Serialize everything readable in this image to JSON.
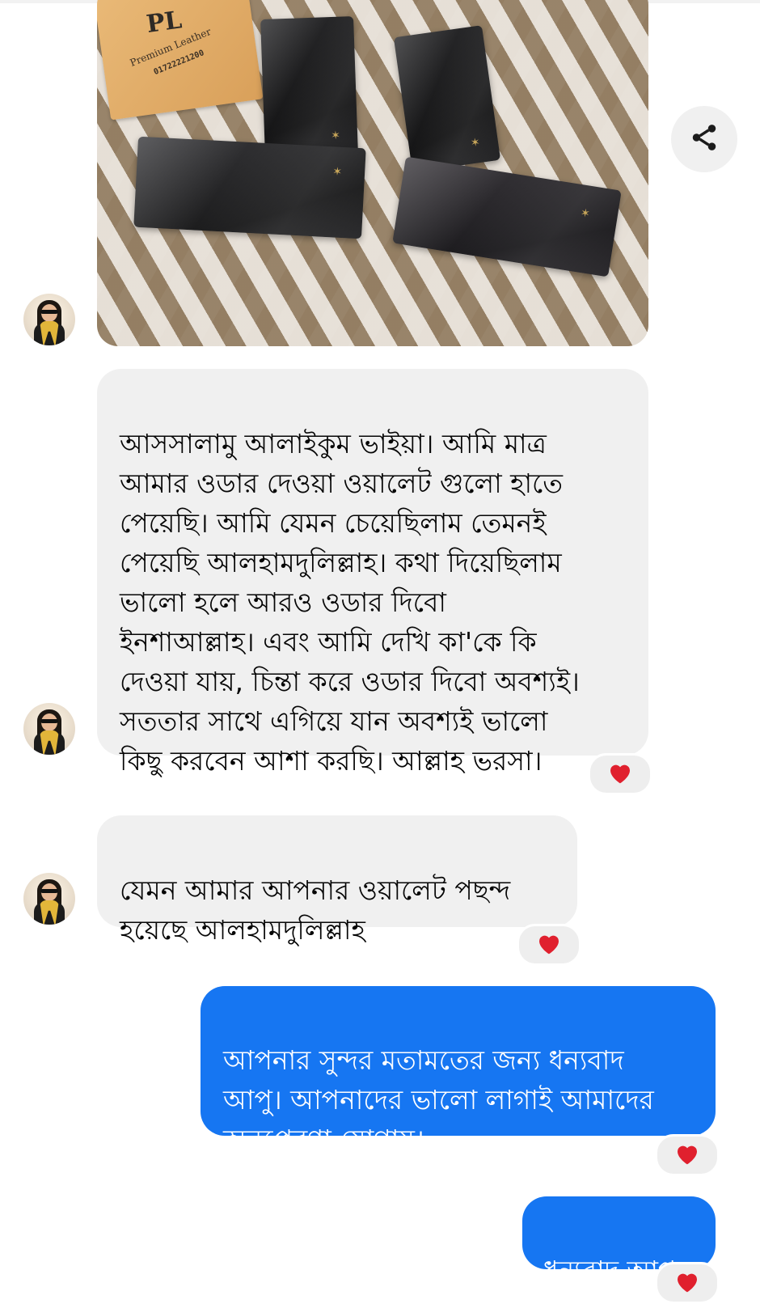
{
  "messages": [
    {
      "direction": "incoming",
      "type": "image",
      "image_tag": {
        "logo": "PL",
        "brand": "Premium Leather",
        "phone": "01722221200"
      }
    },
    {
      "direction": "incoming",
      "type": "text",
      "text": "আসসালামু আলাইকুম ভাইয়া। আমি মাত্র\nআমার ওডার দেওয়া ওয়ালেট গুলো হাতে\nপেয়েছি। আমি যেমন চেয়েছিলাম তেমনই\nপেয়েছি আলহামদুলিল্লাহ। কথা দিয়েছিলাম\nভালো হলে আরও ওডার দিবো\nইনশাআল্লাহ। এবং আমি দেখি কা'কে কি\nদেওয়া যায়, চিন্তা করে ওডার দিবো অবশ্যই।\nসততার সাথে এগিয়ে যান অবশ্যই ভালো\nকিছু করবেন আশা করছি। আল্লাহ ভরসা।",
      "reaction": "heart"
    },
    {
      "direction": "incoming",
      "type": "text",
      "text": "যেমন আমার আপনার ওয়ালেট পছন্দ\nহয়েছে আলহামদুলিল্লাহ",
      "reaction": "heart"
    },
    {
      "direction": "outgoing",
      "type": "text",
      "text": "আপনার সুন্দর মতামতের জন্য ধন্যবাদ\nআপু। আপনাদের ভালো লাগাই আমাদের\nঅনুপ্রেরণা যোগায়।",
      "reaction": "heart"
    },
    {
      "direction": "outgoing",
      "type": "text",
      "text": "ধন্যবাদ আপু",
      "reaction": "heart"
    }
  ],
  "share_button": {
    "icon": "share-icon"
  },
  "colors": {
    "incoming_bubble": "#f0f0f0",
    "outgoing_bubble": "#1676f2",
    "reaction_heart": "#e0202e",
    "background": "#ffffff"
  }
}
